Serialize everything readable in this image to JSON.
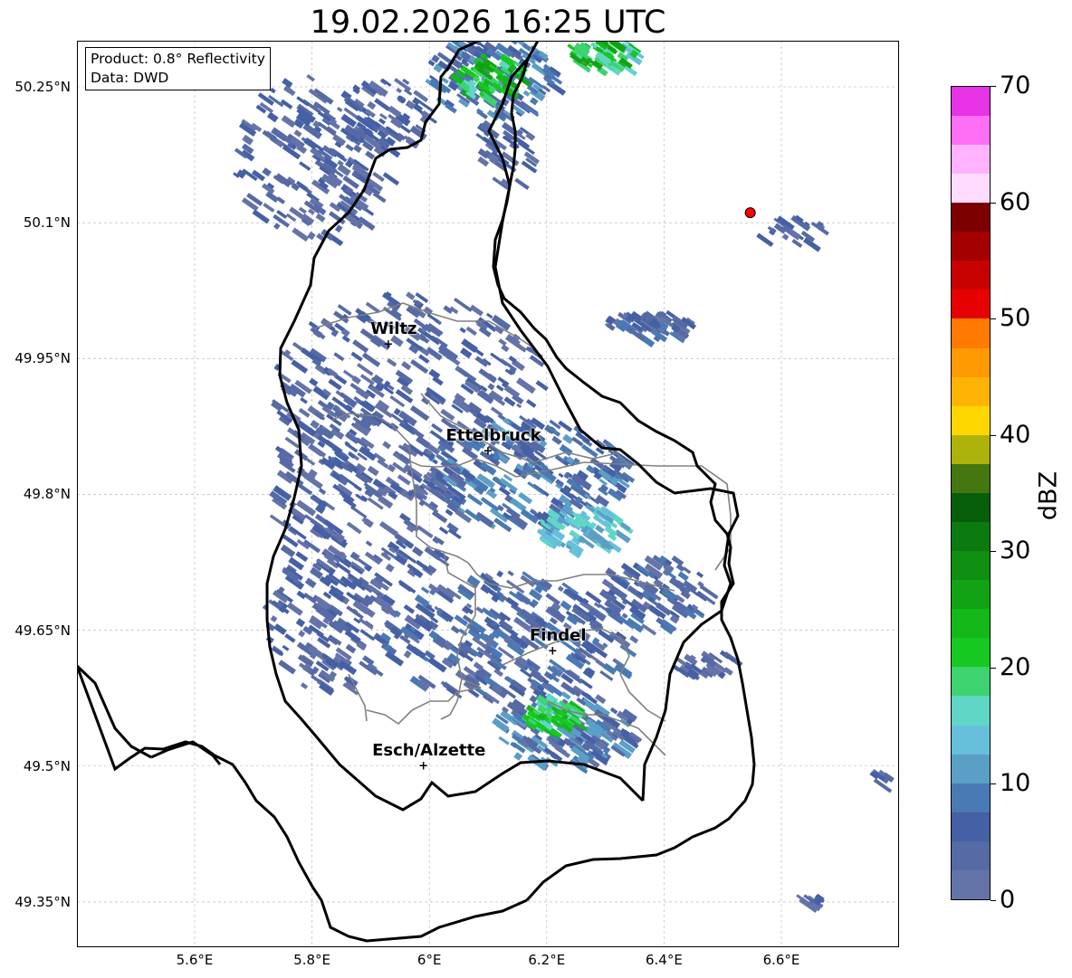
{
  "title": "19.02.2026 16:25 UTC",
  "info_box": {
    "product": "Product: 0.8° Reflectivity",
    "source": "Data: DWD"
  },
  "axes": {
    "lon_range": [
      5.42,
      6.82
    ],
    "lat_range": [
      49.3,
      50.3
    ],
    "lat_ticks": [
      {
        "value": 50.25,
        "label": "50.25°N"
      },
      {
        "value": 50.1,
        "label": "50.1°N"
      },
      {
        "value": 49.95,
        "label": "49.95°N"
      },
      {
        "value": 49.8,
        "label": "49.8°N"
      },
      {
        "value": 49.65,
        "label": "49.65°N"
      },
      {
        "value": 49.5,
        "label": "49.5°N"
      },
      {
        "value": 49.35,
        "label": "49.35°N"
      }
    ],
    "lon_ticks": [
      {
        "value": 5.6,
        "label": "5.6°E"
      },
      {
        "value": 5.8,
        "label": "5.8°E"
      },
      {
        "value": 6.0,
        "label": "6°E"
      },
      {
        "value": 6.2,
        "label": "6.2°E"
      },
      {
        "value": 6.4,
        "label": "6.4°E"
      },
      {
        "value": 6.6,
        "label": "6.6°E"
      }
    ],
    "gridlines": true
  },
  "cities": [
    {
      "name": "Wiltz",
      "lon": 5.93,
      "lat": 49.965
    },
    {
      "name": "Ettelbruck",
      "lon": 6.1,
      "lat": 49.847
    },
    {
      "name": "Findel",
      "lon": 6.21,
      "lat": 49.627
    },
    {
      "name": "Esch/Alzette",
      "lon": 5.99,
      "lat": 49.5
    }
  ],
  "radar_site": {
    "lon": 6.547,
    "lat": 50.111,
    "color": "#ff0000"
  },
  "colorbar": {
    "unit": "dBZ",
    "min": 0,
    "max": 70,
    "ticks": [
      "0",
      "10",
      "20",
      "30",
      "40",
      "50",
      "60",
      "70"
    ],
    "colors": [
      "#6473a8",
      "#566aa5",
      "#4560a4",
      "#4a7ab4",
      "#5b9ec6",
      "#66c0dc",
      "#5fd6c6",
      "#3dd36f",
      "#16c81f",
      "#14b819",
      "#12a314",
      "#0e8f12",
      "#0b7a0f",
      "#075f0b",
      "#447710",
      "#aeb30c",
      "#ffd700",
      "#ffb405",
      "#ff9a00",
      "#ff7a00",
      "#e60000",
      "#c70000",
      "#a50000",
      "#7d0000",
      "#ffdcff",
      "#ffb3ff",
      "#ff6ff5",
      "#e633e6"
    ]
  }
}
